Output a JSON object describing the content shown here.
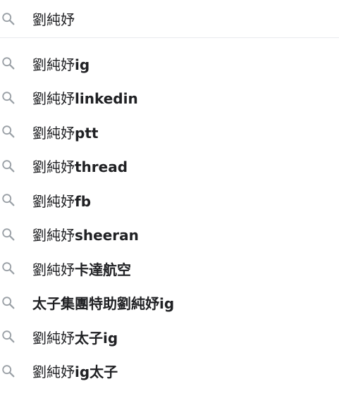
{
  "search": {
    "query": "劉純妤",
    "icon": "search-icon"
  },
  "suggestions": [
    {
      "plain": "劉純妤",
      "bold": "ig"
    },
    {
      "plain": "劉純妤",
      "bold": "linkedin"
    },
    {
      "plain": "劉純妤",
      "bold": "ptt"
    },
    {
      "plain": "劉純妤",
      "bold": "thread"
    },
    {
      "plain": "劉純妤",
      "bold": "fb"
    },
    {
      "plain": "劉純妤",
      "bold": "sheeran"
    },
    {
      "plain": "劉純妤",
      "bold": "卡達航空"
    },
    {
      "plain": "",
      "bold": "太子集團特助劉純妤ig"
    },
    {
      "plain": "劉純妤",
      "bold": "太子ig"
    },
    {
      "plain": "劉純妤",
      "bold": "ig太子"
    }
  ],
  "colors": {
    "icon": "#9aa0a6",
    "text": "#202124",
    "divider": "#e8eaed"
  }
}
